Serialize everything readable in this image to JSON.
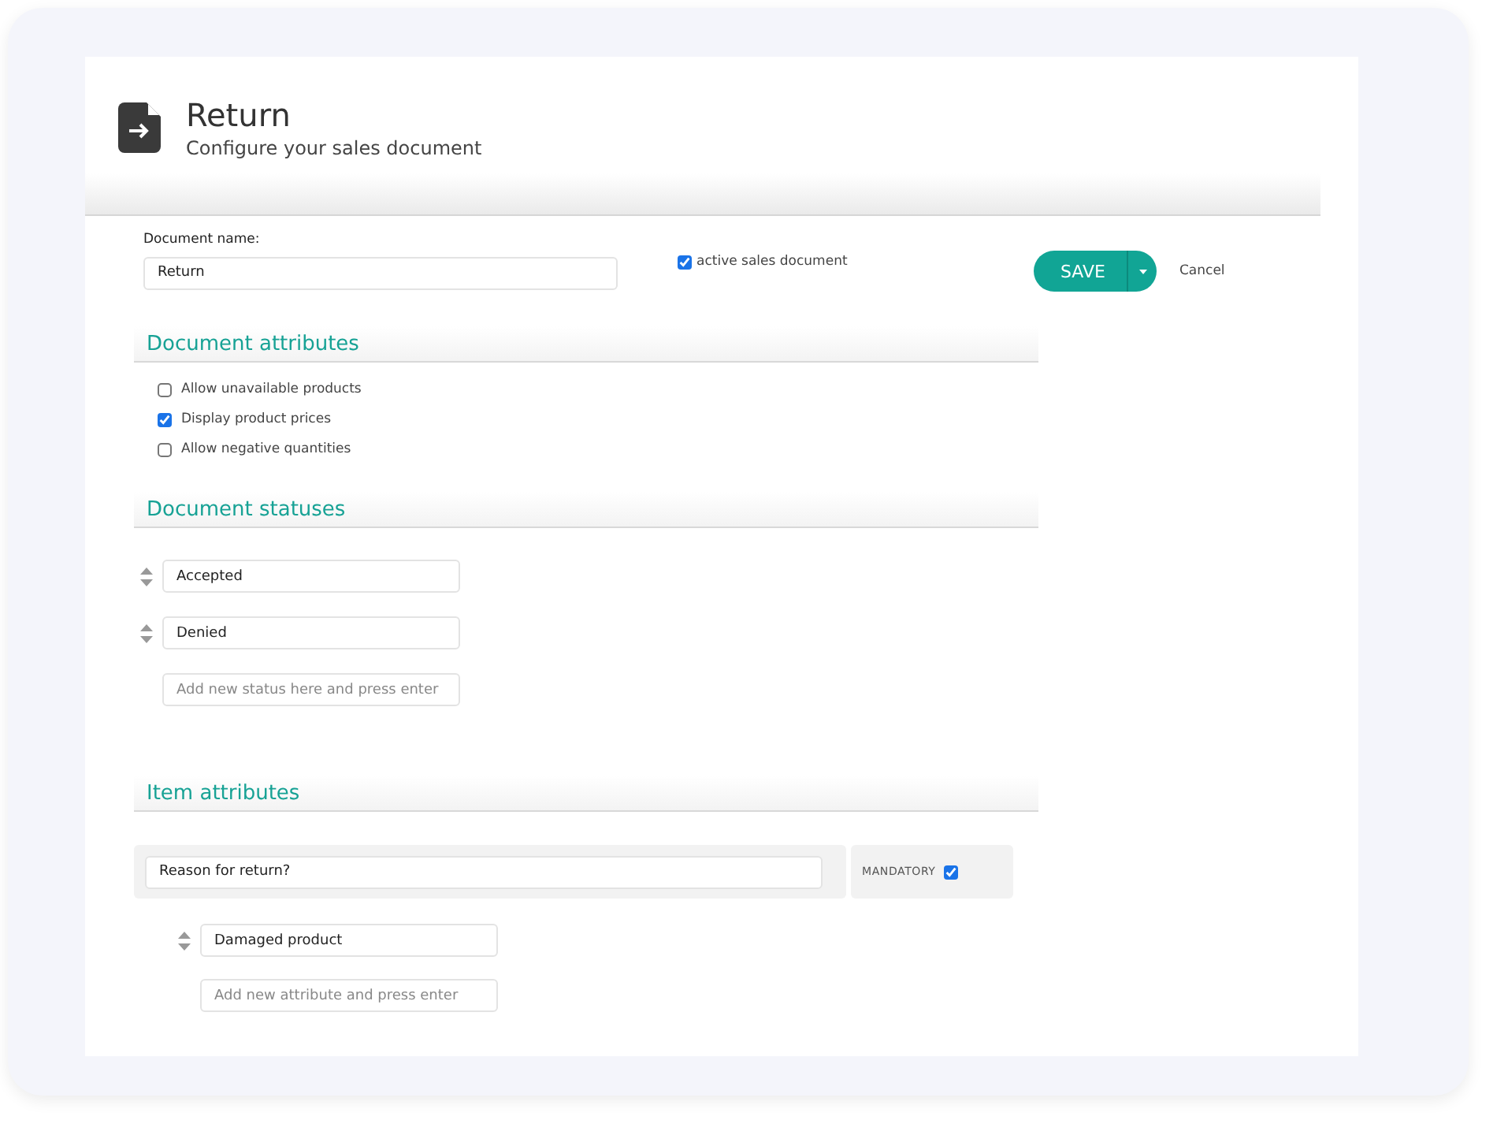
{
  "header": {
    "title": "Return",
    "subtitle": "Configure your sales document"
  },
  "document_name": {
    "label": "Document name:",
    "value": "Return"
  },
  "active_document": {
    "label": "active sales document",
    "checked": true
  },
  "save_button": {
    "label": "SAVE"
  },
  "cancel_link": {
    "label": "Cancel"
  },
  "document_attributes": {
    "heading": "Document attributes",
    "options": [
      {
        "label": "Allow unavailable products",
        "checked": false
      },
      {
        "label": "Display product prices",
        "checked": true
      },
      {
        "label": "Allow negative quantities",
        "checked": false
      }
    ]
  },
  "document_statuses": {
    "heading": "Document statuses",
    "statuses": [
      "Accepted",
      "Denied"
    ],
    "new_status": {
      "placeholder": "Add new status here and press enter"
    }
  },
  "item_attributes": {
    "heading": "Item attributes",
    "attributes": [
      {
        "question": "Reason for return?",
        "mandatory_label": "MANDATORY",
        "mandatory": true,
        "values": [
          "Damaged product"
        ],
        "new_value": {
          "placeholder": "Add new attribute and press enter"
        }
      }
    ]
  }
}
